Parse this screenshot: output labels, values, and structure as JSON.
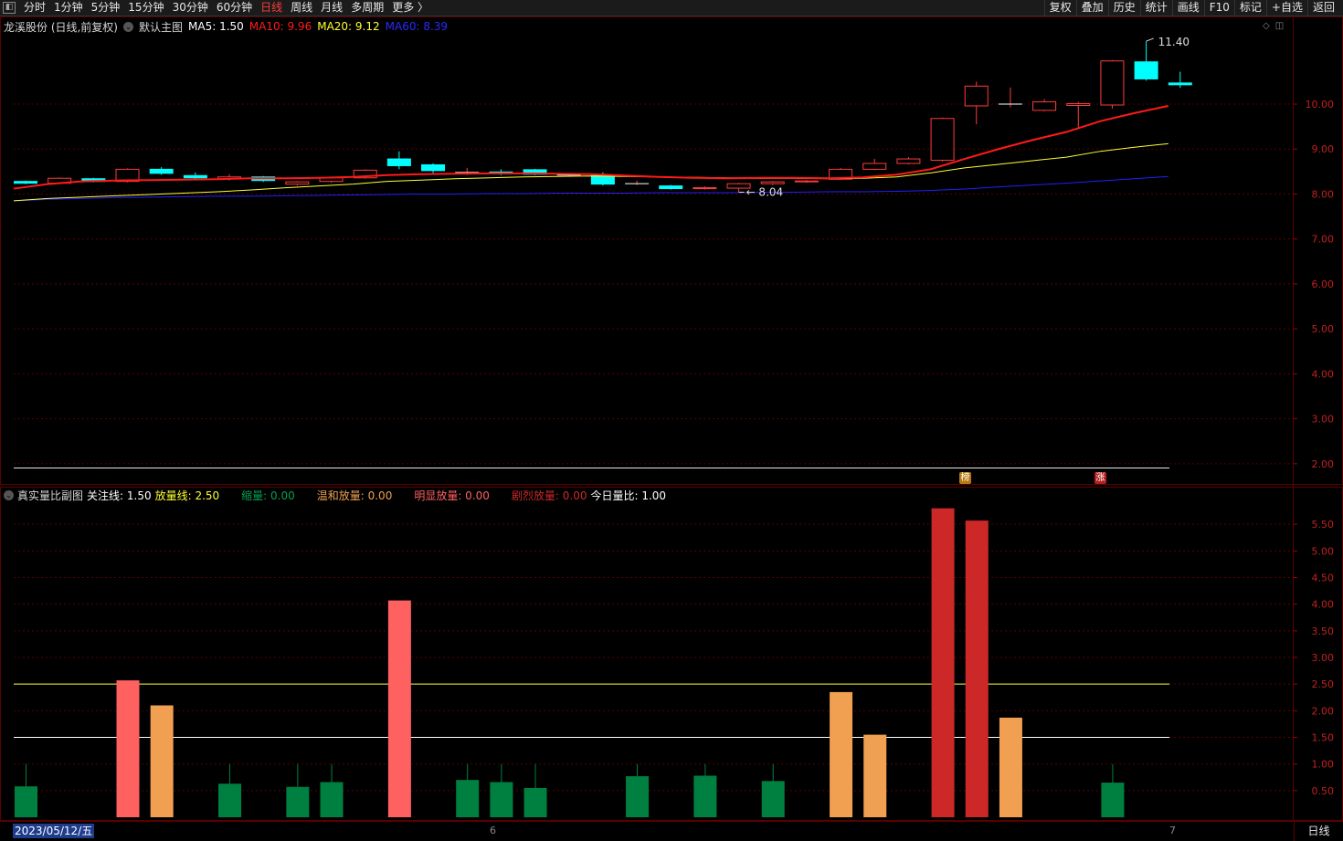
{
  "topbar": {
    "collapse_icon": "sidebar-collapse-icon",
    "periods": [
      "分时",
      "1分钟",
      "5分钟",
      "15分钟",
      "30分钟",
      "60分钟",
      "日线",
      "周线",
      "月线",
      "多周期",
      "更多 〉"
    ],
    "active_period": "日线",
    "tools": [
      "复权",
      "叠加",
      "历史",
      "统计",
      "画线",
      "F10",
      "标记",
      "+自选",
      "返回"
    ]
  },
  "main_legend": {
    "title": "龙溪股份 (日线,前复权)",
    "dropdown_icon": "circle-chevron-down-icon",
    "chart_name": "默认主图",
    "ma5": "MA5: 1.50",
    "ma10": "MA10: 9.96",
    "ma20": "MA20: 9.12",
    "ma60": "MA60: 8.39"
  },
  "sub_legend": {
    "dropdown_icon": "circle-chevron-down-icon",
    "title": "真实量比副图",
    "watch_line": "关注线: 1.50",
    "volume_line": "放量线: 2.50",
    "shrink": "缩量: 0.00",
    "mild": "温和放量: 0.00",
    "obvious": "明显放量: 0.00",
    "violent": "剧烈放量: 0.00",
    "today": "今日量比: 1.00"
  },
  "date_bar": {
    "current_date": "2023/05/12/五",
    "month_ticks": [
      "6",
      "7"
    ],
    "period": "日线"
  },
  "badges": [
    "榜",
    "涨"
  ],
  "colors": {
    "up": "#ff3b3b",
    "down": "#00ffff",
    "ma5": "#ffffff",
    "ma10": "#ff1a1a",
    "ma20": "#ffff33",
    "ma60": "#2020ff",
    "shrink": "#008040",
    "mild": "#f0a050",
    "obvious": "#ff6060",
    "violent": "#cc2828"
  },
  "chart_data": [
    {
      "type": "candlestick",
      "ylim": [
        1.55,
        11.95
      ],
      "yticks": [
        "2.00",
        "3.00",
        "4.00",
        "5.00",
        "6.00",
        "7.00",
        "8.00",
        "9.00",
        "10.00"
      ],
      "annotations": {
        "high": "11.40",
        "low": "8.04"
      },
      "candles": [
        {
          "o": 8.28,
          "c": 8.24,
          "h": 8.3,
          "l": 8.22
        },
        {
          "o": 8.24,
          "c": 8.35,
          "h": 8.37,
          "l": 8.22
        },
        {
          "o": 8.34,
          "c": 8.28,
          "h": 8.36,
          "l": 8.26
        },
        {
          "o": 8.28,
          "c": 8.55,
          "h": 8.57,
          "l": 8.26
        },
        {
          "o": 8.55,
          "c": 8.46,
          "h": 8.6,
          "l": 8.43
        },
        {
          "o": 8.41,
          "c": 8.36,
          "h": 8.48,
          "l": 8.33
        },
        {
          "o": 8.34,
          "c": 8.38,
          "h": 8.44,
          "l": 8.3
        },
        {
          "o": 8.38,
          "c": 8.3,
          "h": 8.4,
          "l": 8.27
        },
        {
          "o": 8.22,
          "c": 8.27,
          "h": 8.29,
          "l": 8.19
        },
        {
          "o": 8.28,
          "c": 8.36,
          "h": 8.38,
          "l": 8.25
        },
        {
          "o": 8.36,
          "c": 8.53,
          "h": 8.55,
          "l": 8.34
        },
        {
          "o": 8.78,
          "c": 8.63,
          "h": 8.95,
          "l": 8.55
        },
        {
          "o": 8.65,
          "c": 8.52,
          "h": 8.68,
          "l": 8.46
        },
        {
          "o": 8.47,
          "c": 8.48,
          "h": 8.58,
          "l": 8.42
        },
        {
          "o": 8.49,
          "c": 8.47,
          "h": 8.55,
          "l": 8.42
        },
        {
          "o": 8.54,
          "c": 8.44,
          "h": 8.56,
          "l": 8.42
        },
        {
          "o": 8.42,
          "c": 8.42,
          "h": 8.44,
          "l": 8.4
        },
        {
          "o": 8.41,
          "c": 8.22,
          "h": 8.48,
          "l": 8.19
        },
        {
          "o": 8.23,
          "c": 8.23,
          "h": 8.3,
          "l": 8.2
        },
        {
          "o": 8.18,
          "c": 8.12,
          "h": 8.2,
          "l": 8.1
        },
        {
          "o": 8.12,
          "c": 8.14,
          "h": 8.17,
          "l": 8.1
        },
        {
          "o": 8.13,
          "c": 8.23,
          "h": 8.25,
          "l": 8.04
        },
        {
          "o": 8.23,
          "c": 8.27,
          "h": 8.29,
          "l": 8.2
        },
        {
          "o": 8.27,
          "c": 8.29,
          "h": 8.31,
          "l": 8.25
        },
        {
          "o": 8.33,
          "c": 8.55,
          "h": 8.58,
          "l": 8.31
        },
        {
          "o": 8.55,
          "c": 8.68,
          "h": 8.78,
          "l": 8.53
        },
        {
          "o": 8.68,
          "c": 8.78,
          "h": 8.82,
          "l": 8.66
        },
        {
          "o": 8.75,
          "c": 9.68,
          "h": 9.7,
          "l": 8.72
        },
        {
          "o": 9.96,
          "c": 10.4,
          "h": 10.5,
          "l": 9.55
        },
        {
          "o": 9.99,
          "c": 10.0,
          "h": 10.37,
          "l": 9.93
        },
        {
          "o": 9.86,
          "c": 10.05,
          "h": 10.11,
          "l": 9.84
        },
        {
          "o": 9.97,
          "c": 10.01,
          "h": 10.05,
          "l": 9.45
        },
        {
          "o": 9.98,
          "c": 10.96,
          "h": 10.98,
          "l": 9.9
        },
        {
          "o": 10.94,
          "c": 10.56,
          "h": 11.4,
          "l": 10.52
        },
        {
          "o": 10.47,
          "c": 10.43,
          "h": 10.72,
          "l": 10.36
        }
      ],
      "ma10": [
        8.12,
        8.22,
        8.28,
        8.3,
        8.31,
        8.32,
        8.33,
        8.35,
        8.35,
        8.36,
        8.38,
        8.42,
        8.44,
        8.45,
        8.46,
        8.46,
        8.45,
        8.44,
        8.41,
        8.38,
        8.36,
        8.35,
        8.36,
        8.36,
        8.35,
        8.37,
        8.43,
        8.55,
        8.78,
        9.0,
        9.2,
        9.38,
        9.62,
        9.8,
        9.96
      ],
      "ma20": [
        7.85,
        7.9,
        7.93,
        7.96,
        7.99,
        8.02,
        8.05,
        8.09,
        8.14,
        8.18,
        8.22,
        8.28,
        8.31,
        8.34,
        8.36,
        8.38,
        8.39,
        8.4,
        8.39,
        8.38,
        8.37,
        8.36,
        8.35,
        8.35,
        8.34,
        8.35,
        8.38,
        8.47,
        8.58,
        8.66,
        8.74,
        8.82,
        8.95,
        9.04,
        9.12
      ],
      "ma60": [
        7.85,
        7.88,
        7.9,
        7.92,
        7.93,
        7.94,
        7.95,
        7.95,
        7.96,
        7.97,
        7.98,
        7.99,
        8.0,
        8.0,
        8.01,
        8.01,
        8.02,
        8.02,
        8.02,
        8.03,
        8.03,
        8.03,
        8.04,
        8.04,
        8.05,
        8.05,
        8.06,
        8.08,
        8.11,
        8.16,
        8.2,
        8.24,
        8.29,
        8.34,
        8.39
      ]
    },
    {
      "type": "bar",
      "title": "真实量比副图",
      "ylim": [
        0.0,
        6.0
      ],
      "yticks": [
        "0.50",
        "1.00",
        "1.50",
        "2.00",
        "2.50",
        "3.00",
        "3.50",
        "4.00",
        "4.50",
        "5.00",
        "5.50"
      ],
      "reference_lines": {
        "watch": 1.5,
        "volume": 2.5
      },
      "categories_count": 35,
      "values": [
        0.58,
        0,
        0,
        2.57,
        2.1,
        0,
        0.63,
        0,
        0.57,
        0.66,
        0,
        4.07,
        0,
        0.7,
        0.66,
        0.55,
        0,
        0,
        0.77,
        0,
        0.78,
        0,
        0.68,
        0,
        2.35,
        1.55,
        0,
        5.8,
        5.57,
        1.87,
        0,
        0,
        0.65,
        0,
        0
      ],
      "levels": [
        "shrink",
        "",
        "",
        "obvious",
        "mild",
        "",
        "shrink",
        "",
        "shrink",
        "shrink",
        "",
        "obvious",
        "",
        "shrink",
        "shrink",
        "shrink",
        "",
        "",
        "shrink",
        "",
        "shrink",
        "",
        "shrink",
        "",
        "mild",
        "mild",
        "",
        "violent",
        "violent",
        "mild",
        "",
        "",
        "shrink",
        "",
        ""
      ],
      "marker": [
        1,
        0,
        0,
        0,
        0,
        0,
        1,
        0,
        1,
        1,
        0,
        0,
        0,
        1,
        1,
        1,
        0,
        0,
        1,
        0,
        1,
        0,
        1,
        0,
        0,
        0,
        0,
        0,
        0,
        0,
        0,
        0,
        1,
        0,
        0
      ]
    }
  ]
}
